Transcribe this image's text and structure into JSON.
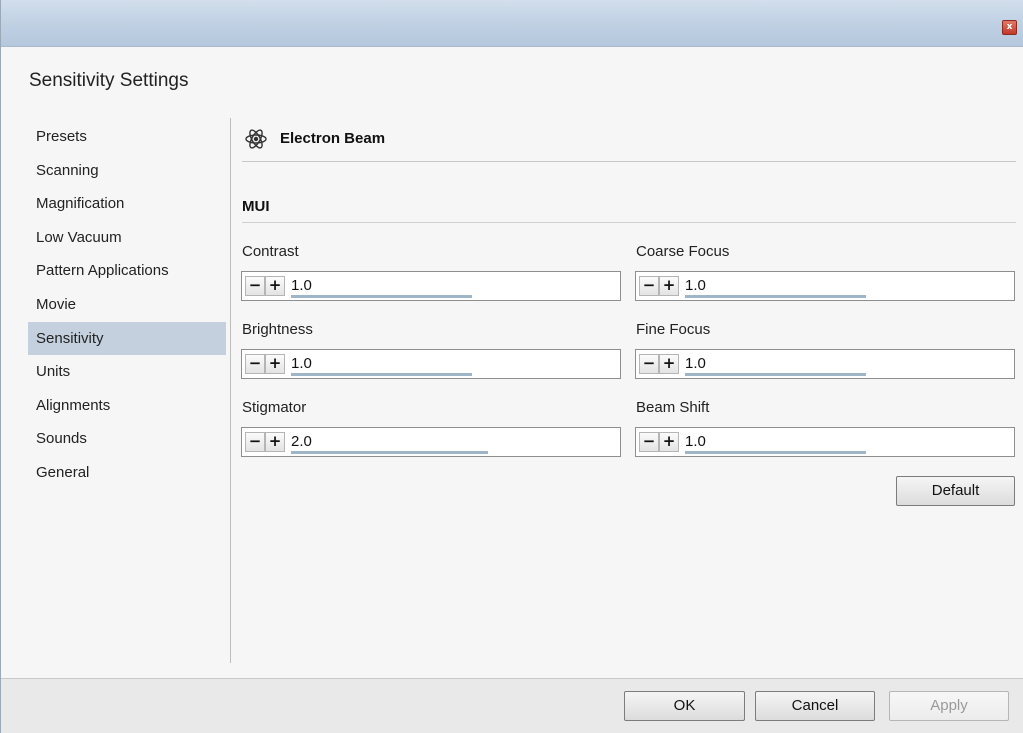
{
  "window": {
    "close_label": "x"
  },
  "dialog": {
    "title": "Sensitivity Settings"
  },
  "sidebar": {
    "items": [
      {
        "label": "Presets"
      },
      {
        "label": "Scanning"
      },
      {
        "label": "Magnification"
      },
      {
        "label": "Low Vacuum"
      },
      {
        "label": "Pattern Applications"
      },
      {
        "label": "Movie"
      },
      {
        "label": "Sensitivity",
        "selected": true
      },
      {
        "label": "Units"
      },
      {
        "label": "Alignments"
      },
      {
        "label": "Sounds"
      },
      {
        "label": "General"
      }
    ]
  },
  "section": {
    "icon": "atom-icon",
    "title": "Electron Beam"
  },
  "group": {
    "title": "MUI"
  },
  "fields": {
    "contrast": {
      "label": "Contrast",
      "value": "1.0"
    },
    "coarse_focus": {
      "label": "Coarse Focus",
      "value": "1.0"
    },
    "brightness": {
      "label": "Brightness",
      "value": "1.0"
    },
    "fine_focus": {
      "label": "Fine Focus",
      "value": "1.0"
    },
    "stigmator": {
      "label": "Stigmator",
      "value": "2.0"
    },
    "beam_shift": {
      "label": "Beam Shift",
      "value": "1.0"
    },
    "minus_label": "−",
    "plus_label": "+"
  },
  "buttons": {
    "default": "Default",
    "ok": "OK",
    "cancel": "Cancel",
    "apply": "Apply"
  },
  "colors": {
    "selected_item_bg": "#c5d0de",
    "titlebar": "#bfd0e3",
    "value_bar": "#9fb6c9"
  }
}
